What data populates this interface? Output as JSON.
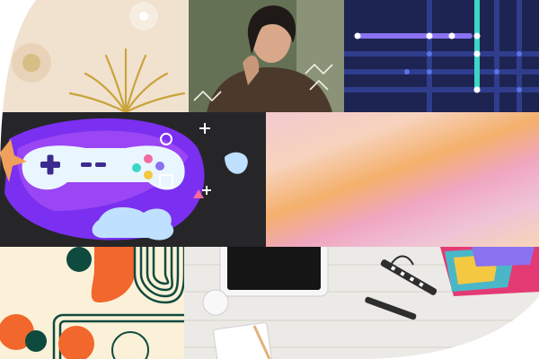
{
  "collage": {
    "tiles": [
      {
        "id": "abstract-sun",
        "description_colors": [
          "#f1e1cf",
          "#c9a43a"
        ]
      },
      {
        "id": "portrait-photo",
        "description_colors": [
          "#5d6a50",
          "#4b3a2b"
        ]
      },
      {
        "id": "grid-lines",
        "description_colors": [
          "#1e2452",
          "#8a72f0",
          "#3bd6c6"
        ]
      },
      {
        "id": "gamepad-illustration",
        "description_colors": [
          "#262629",
          "#8a3df0",
          "#e9f6ff"
        ]
      },
      {
        "id": "gradient-blur",
        "description_colors": [
          "#f2c9cf",
          "#f4b06c",
          "#f0a6c0"
        ]
      },
      {
        "id": "geometric-shapes",
        "description_colors": [
          "#fbf1d8",
          "#f2672b",
          "#0f4a3f"
        ]
      },
      {
        "id": "desk-photo",
        "description_colors": [
          "#eceae6",
          "#e43a74",
          "#2e2e2e"
        ]
      }
    ]
  }
}
